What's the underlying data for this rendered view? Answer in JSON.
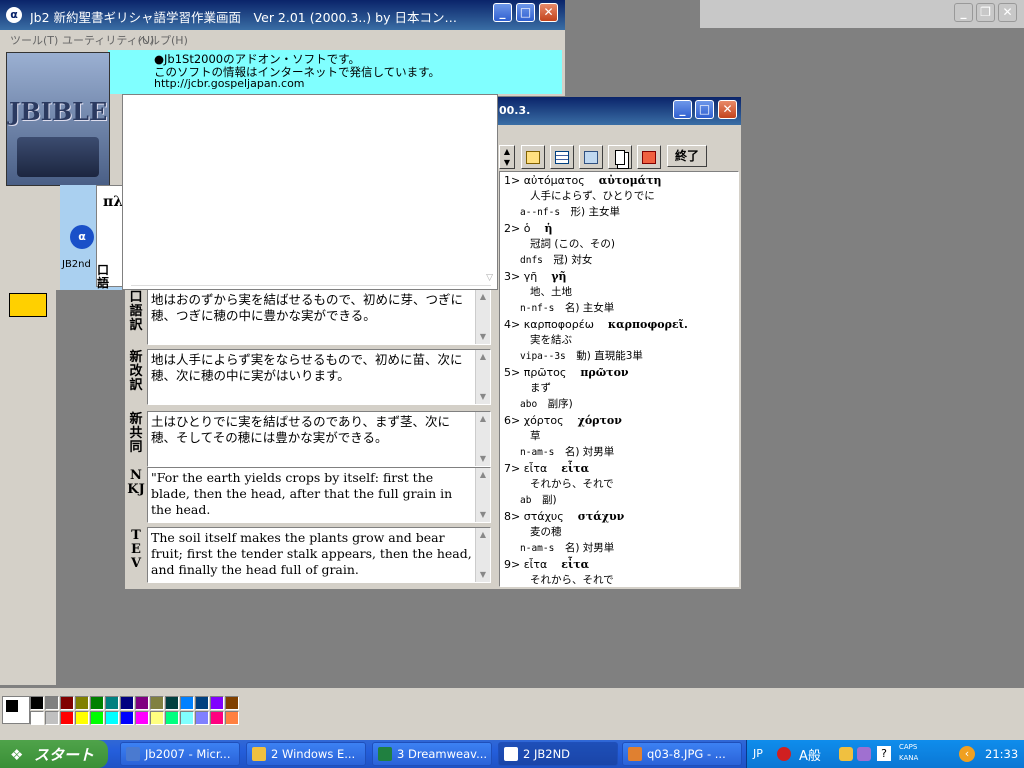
{
  "main_window": {
    "title": "Jb2 新約聖書ギリシャ語学習作業画面　Ver 2.01 (2000.3..) by 日本コン…",
    "menu": [
      "ツール(T)",
      "ユーティリティ(U)",
      "ヘルプ(H)"
    ],
    "info_lines": [
      "●Jb1St2000のアドオン・ソフトです。",
      "このソフトの情報はインターネットで発信しています。",
      "http://jcbr.gospeljapan.com"
    ],
    "logo_text": "JBIBLE"
  },
  "desktop_icon": {
    "label": "JB2nd"
  },
  "partial_text": {
    "greek_left": "πλ",
    "label_left": "口語",
    "title_fragment": "00.3."
  },
  "translations": [
    {
      "label": "口語訳",
      "text": "地はおのずから実を結ばせるもので、初めに芽、つぎに穂、つぎに穂の中に豊かな実ができる。"
    },
    {
      "label": "新改訳",
      "text": "地は人手によらず実をならせるもので、初めに苗、次に穂、次に穂の中に実がはいります。"
    },
    {
      "label": "新共同",
      "text": "土はひとりでに実を結ばせるのであり、まず茎、次に穂、そしてその穂には豊かな実ができる。"
    },
    {
      "label": "NKJ",
      "text": "\"For the earth yields crops by itself: first the blade, then the head, after that the full grain in the head."
    },
    {
      "label": "TEV",
      "text": "The soil itself makes the plants grow and bear fruit; first the tender stalk appears, then the head, and finally the head full of grain."
    }
  ],
  "toolbar": {
    "exit_label": "終了"
  },
  "vocab": [
    {
      "num": "1>",
      "word": "αὐτόματος",
      "form": "αὐτομάτη",
      "meaning": "人手によらず、ひとりでに",
      "parse": "a--nf-s",
      "gram": "形) 主女単"
    },
    {
      "num": "2>",
      "word": "ὁ",
      "form": "ἡ",
      "meaning": "冠詞 (この、その)",
      "parse": "dnfs",
      "gram": "冠) 対女"
    },
    {
      "num": "3>",
      "word": "γῆ",
      "form": "γῆ",
      "meaning": "地、土地",
      "parse": "n-nf-s",
      "gram": "名) 主女単"
    },
    {
      "num": "4>",
      "word": "καρποφορέω",
      "form": "καρποφορεῖ.",
      "meaning": "実を結ぶ",
      "parse": "vipa--3s",
      "gram": "動) 直現能3単"
    },
    {
      "num": "5>",
      "word": "πρῶτος",
      "form": "πρῶτον",
      "meaning": "まず",
      "parse": "abo",
      "gram": "副序)"
    },
    {
      "num": "6>",
      "word": "χόρτος",
      "form": "χόρτον",
      "meaning": "草",
      "parse": "n-am-s",
      "gram": "名) 対男単"
    },
    {
      "num": "7>",
      "word": "εἶτα",
      "form": "εἶτα",
      "meaning": "それから、それで",
      "parse": "ab",
      "gram": "副)"
    },
    {
      "num": "8>",
      "word": "στάχυς",
      "form": "στάχυν",
      "meaning": "麦の穂",
      "parse": "n-am-s",
      "gram": "名) 対男単"
    },
    {
      "num": "9>",
      "word": "εἶτα",
      "form": "εἶτα",
      "meaning": "それから、それで",
      "parse": "",
      "gram": ""
    }
  ],
  "taskbar": {
    "start_label": "スタート",
    "items": [
      "Jb2007 - Micr...",
      "2 Windows E...",
      "3 Dreamweav...",
      "2 JB2ND",
      "q03-8.JPG - ..."
    ],
    "ime": {
      "lang": "JP",
      "mode": "A般",
      "caps": "CAPS",
      "kana": "KANA"
    },
    "clock": "21:33"
  },
  "palette_colors": [
    "#000000",
    "#808080",
    "#800000",
    "#808000",
    "#008000",
    "#008080",
    "#000080",
    "#800080",
    "#808040",
    "#004040",
    "#0080ff",
    "#004080",
    "#8000ff",
    "#804000",
    "#ffffff",
    "#c0c0c0",
    "#ff0000",
    "#ffff00",
    "#00ff00",
    "#00ffff",
    "#0000ff",
    "#ff00ff",
    "#ffff80",
    "#00ff80",
    "#80ffff",
    "#8080ff",
    "#ff0080",
    "#ff8040"
  ]
}
